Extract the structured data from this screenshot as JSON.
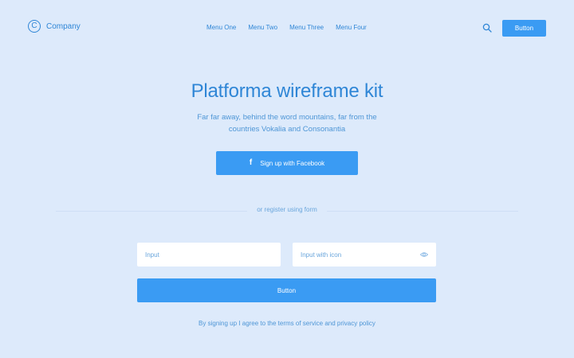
{
  "nav": {
    "logo_mark": "C",
    "brand": "Company",
    "menu": [
      "Menu One",
      "Menu Two",
      "Menu Three",
      "Menu Four"
    ],
    "search_icon": "search-icon",
    "button_label": "Button"
  },
  "hero": {
    "title": "Platforma wireframe kit",
    "subtitle_line1": "Far far away, behind the word mountains, far from the",
    "subtitle_line2": "countries Vokalia and Consonantia",
    "facebook_icon": "f",
    "facebook_label": "Sign up with Facebook"
  },
  "form": {
    "divider_text": "or register using form",
    "input1_placeholder": "Input",
    "input2_placeholder": "Input with icon",
    "input2_icon": "eye-icon",
    "submit_label": "Button",
    "terms": "By signing up I agree to the terms of service and privacy policy"
  },
  "colors": {
    "background": "#ddeafb",
    "accent": "#3a9bf3",
    "text": "#2f86d6"
  }
}
